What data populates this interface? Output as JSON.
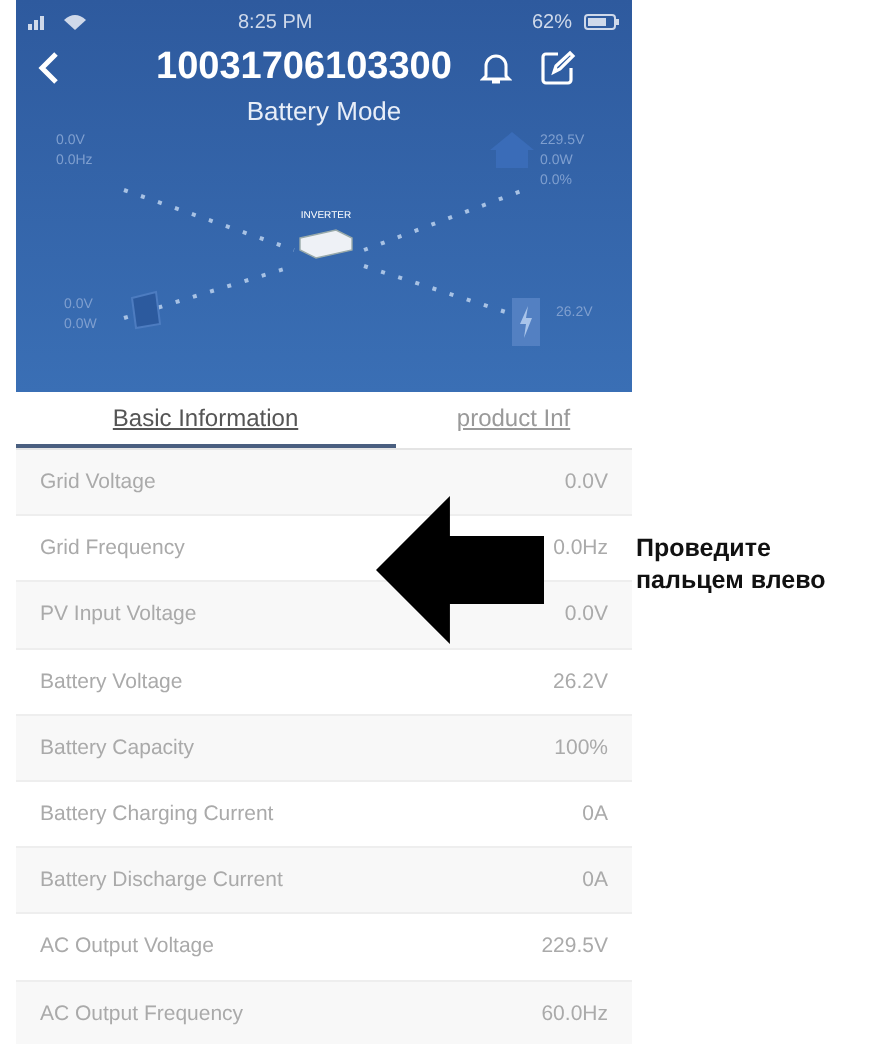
{
  "status_bar": {
    "time": "8:25 PM",
    "battery": "62%"
  },
  "header": {
    "title": "10031706103300",
    "subtitle": "Battery Mode"
  },
  "diagram": {
    "grid": [
      "0.0V",
      "0.0Hz"
    ],
    "load": [
      "229.5V",
      "0.0W",
      "0.0%"
    ],
    "inverter": "INVERTER",
    "pv": [
      "0.0V",
      "0.0W"
    ],
    "battery": [
      "26.2V"
    ]
  },
  "tabs": [
    {
      "label": "Basic Information",
      "selected": true
    },
    {
      "label": "product Inf",
      "selected": false
    }
  ],
  "rows": [
    {
      "label": "Grid Voltage",
      "value": "0.0V"
    },
    {
      "label": "Grid Frequency",
      "value": "0.0Hz"
    },
    {
      "label": "PV Input Voltage",
      "value": "0.0V"
    },
    {
      "label": "Battery Voltage",
      "value": "26.2V"
    },
    {
      "label": "Battery Capacity",
      "value": "100%"
    },
    {
      "label": "Battery Charging Current",
      "value": "0A"
    },
    {
      "label": "Battery Discharge Current",
      "value": "0A"
    },
    {
      "label": "AC Output Voltage",
      "value": "229.5V"
    },
    {
      "label": "AC Output Frequency",
      "value": "60.0Hz"
    }
  ],
  "annotation": {
    "text": "Проведите пальцем влево"
  }
}
